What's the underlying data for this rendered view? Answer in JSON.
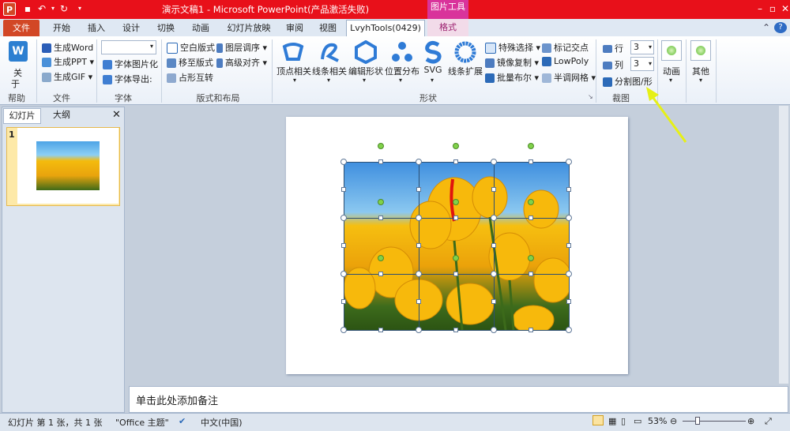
{
  "window": {
    "title": "演示文稿1 - Microsoft PowerPoint(产品激活失败)",
    "context_tab_group": "图片工具",
    "app_icon": "P"
  },
  "tabs": [
    "文件",
    "开始",
    "插入",
    "设计",
    "切换",
    "动画",
    "幻灯片放映",
    "审阅",
    "视图",
    "LvyhTools(0429)",
    "格式"
  ],
  "ribbon": {
    "help": {
      "label": "关\n于",
      "about": "关",
      "about2": "于",
      "group": "帮助"
    },
    "file_group": {
      "items": [
        "生成Word",
        "生成PPT",
        "生成GIF"
      ],
      "group": "文件"
    },
    "font_group": {
      "items": [
        "字体图片化",
        "字体导出:"
      ],
      "group": "字体"
    },
    "layout_group": {
      "items": [
        "空白版式",
        "移至版式",
        "占形互转",
        "图层调序",
        "高级对齐"
      ],
      "group": "版式和布局"
    },
    "shape_group": {
      "items": [
        "顶点相关",
        "线条相关",
        "编辑形状",
        "位置分布",
        "SVG",
        "线条扩展"
      ],
      "right_items": [
        "特殊选择",
        "镜像复制",
        "批量布尔",
        "标记交点",
        "LowPoly",
        "半调网格"
      ],
      "group": "形状"
    },
    "crop_group": {
      "row_label": "行",
      "row_value": "3",
      "col_label": "列",
      "col_value": "3",
      "split": "分割图/形",
      "group": "裁图"
    },
    "anim": "动画",
    "other": "其他"
  },
  "left_pane": {
    "tabs": [
      "幻灯片",
      "大纲"
    ],
    "slide_number": "1"
  },
  "notes_placeholder": "单击此处添加备注",
  "status": {
    "slide_info": "幻灯片 第 1 张，共 1 张",
    "theme": "\"Office 主题\"",
    "language": "中文(中国)",
    "zoom": "53%"
  }
}
